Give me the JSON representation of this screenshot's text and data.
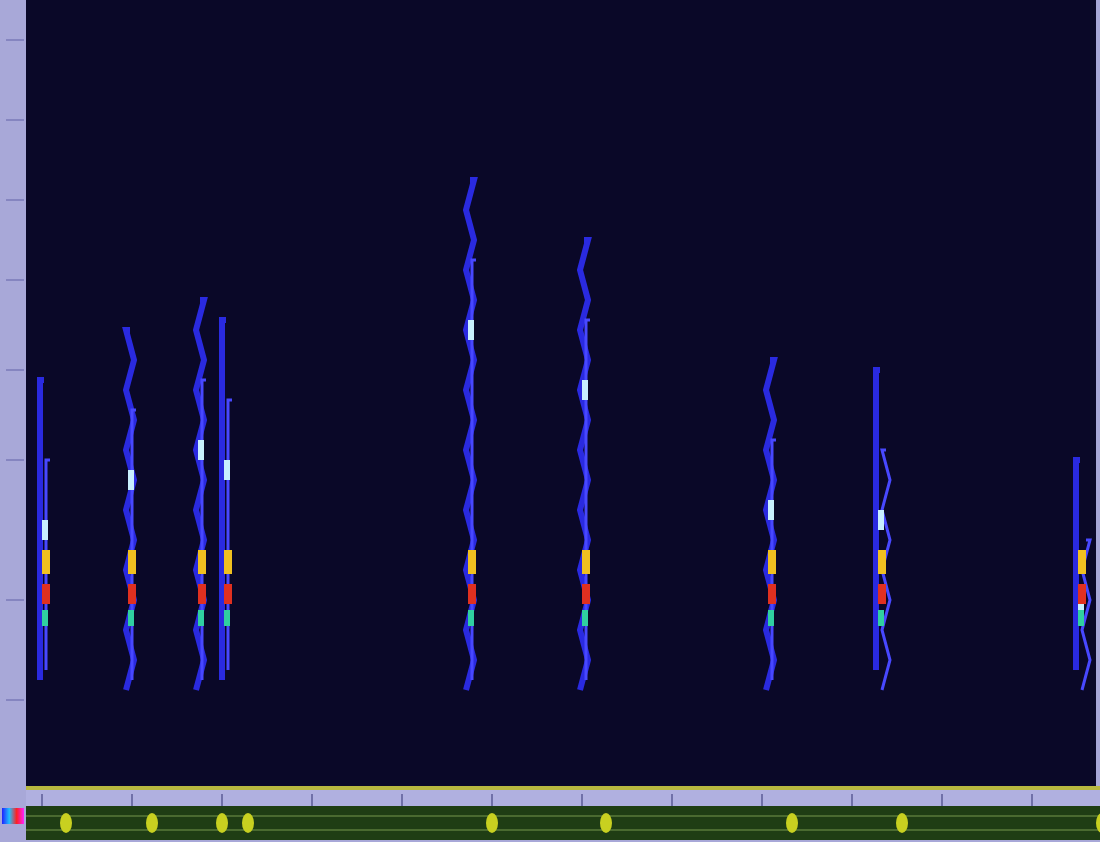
{
  "panels": [
    {
      "kind": "spectrogram"
    },
    {
      "kind": "time-ruler"
    },
    {
      "kind": "overview"
    }
  ]
}
